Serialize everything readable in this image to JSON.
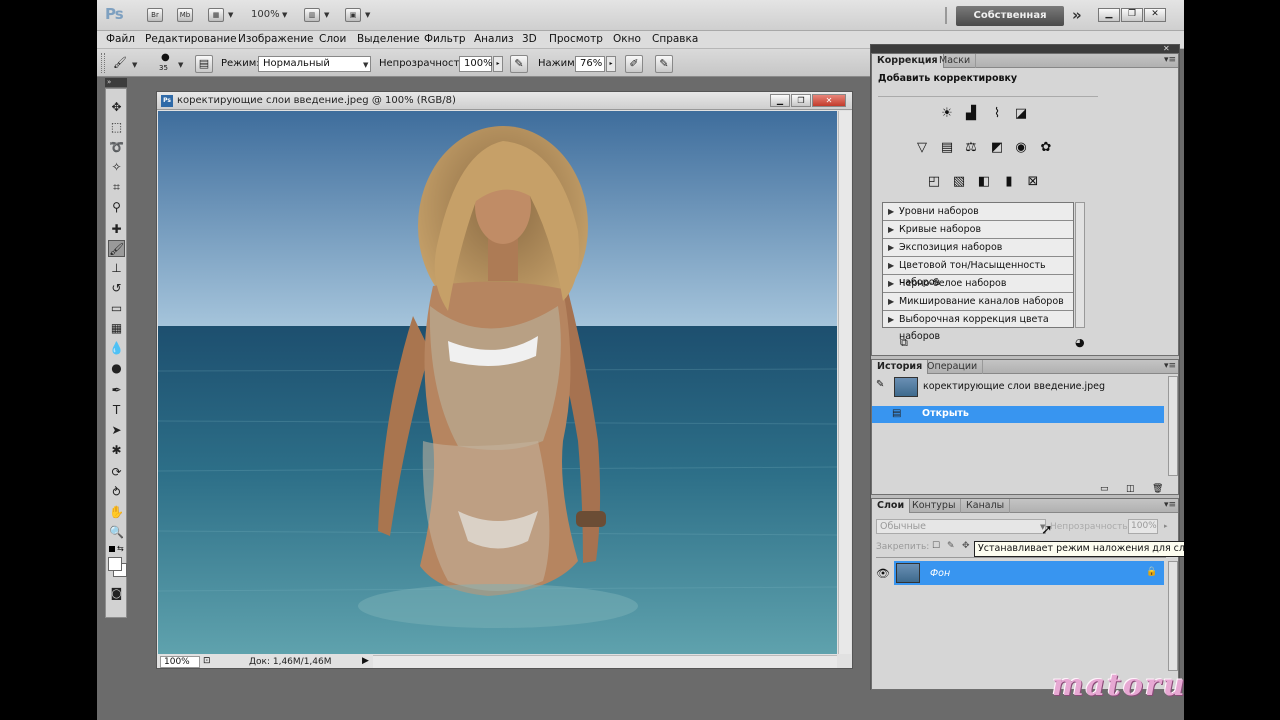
{
  "appbar": {
    "logo": "Ps",
    "zoom": "100%",
    "workspace": "Собственная среда",
    "more": "»",
    "icons": [
      "bridge-icon",
      "minibridge-icon",
      "view-extras-icon",
      "arrange-icon",
      "screen-mode-icon"
    ],
    "btn_br": "Br",
    "btn_mb": "Mb"
  },
  "menu": [
    "Файл",
    "Редактирование",
    "Изображение",
    "Слои",
    "Выделение",
    "Фильтр",
    "Анализ",
    "3D",
    "Просмотр",
    "Окно",
    "Справка"
  ],
  "options": {
    "brush_size": "35",
    "mode_label": "Режим:",
    "mode_value": "Нормальный",
    "opacity_label": "Непрозрачность:",
    "opacity_value": "100%",
    "flow_label": "Нажим:",
    "flow_value": "76%"
  },
  "document": {
    "title": "коректирующие слои введение.jpeg @ 100% (RGB/8)",
    "ps_badge": "Ps",
    "zoom": "100%",
    "doc_size": "Док: 1,46M/1,46M"
  },
  "adjustments": {
    "tabs": [
      "Коррекция",
      "Маски"
    ],
    "heading": "Добавить корректировку",
    "presets": [
      "Уровни наборов",
      "Кривые наборов",
      "Экспозиция наборов",
      "Цветовой тон/Насыщенность наборов",
      "Черно-белое наборов",
      "Микширование каналов наборов",
      "Выборочная коррекция цвета наборов"
    ]
  },
  "history": {
    "tabs": [
      "История",
      "Операции"
    ],
    "snapshot": "коректирующие слои введение.jpeg",
    "step": "Открыть"
  },
  "layers": {
    "tabs": [
      "Слои",
      "Контуры",
      "Каналы"
    ],
    "blend_mode": "Обычные",
    "opacity_label": "Непрозрачность:",
    "opacity_value": "100%",
    "lock_label": "Закрепить:",
    "layer_name": "Фон",
    "tooltip": "Устанавливает режим наложения для слоя"
  },
  "watermark": "matoruev",
  "colors": {
    "selection": "#3895f0",
    "panel": "#d6d6d6",
    "workspace": "#6b6b6b"
  }
}
